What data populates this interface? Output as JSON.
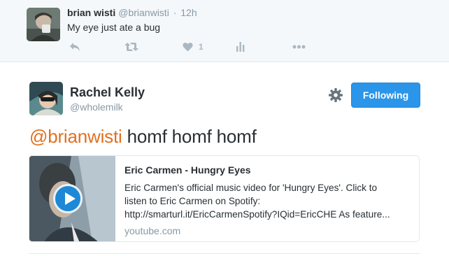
{
  "previous_tweet": {
    "name": "brian wisti",
    "handle": "@brianwisti",
    "separator": "·",
    "time": "12h",
    "text": "My eye just ate a bug",
    "actions": {
      "reply_icon": "reply-icon",
      "retweet_icon": "retweet-icon",
      "like_icon": "heart-icon",
      "like_count": "1",
      "analytics_icon": "analytics-icon",
      "more_icon": "more-icon"
    }
  },
  "tweet": {
    "name": "Rachel Kelly",
    "handle": "@wholemilk",
    "follow_label": "Following",
    "mention": "@brianwisti",
    "text": " homf homf homf",
    "accent_color": "#e2701f",
    "button_color": "#2b95e9"
  },
  "card": {
    "title": "Eric Carmen - Hungry Eyes",
    "description_lines": [
      "Eric Carmen's official music video for 'Hungry Eyes'. Click to",
      "listen to Eric Carmen on Spotify:",
      "http://smarturl.it/EricCarmenSpotify?IQid=EricCHE As feature..."
    ],
    "domain": "youtube.com",
    "play_icon": "play-icon"
  }
}
